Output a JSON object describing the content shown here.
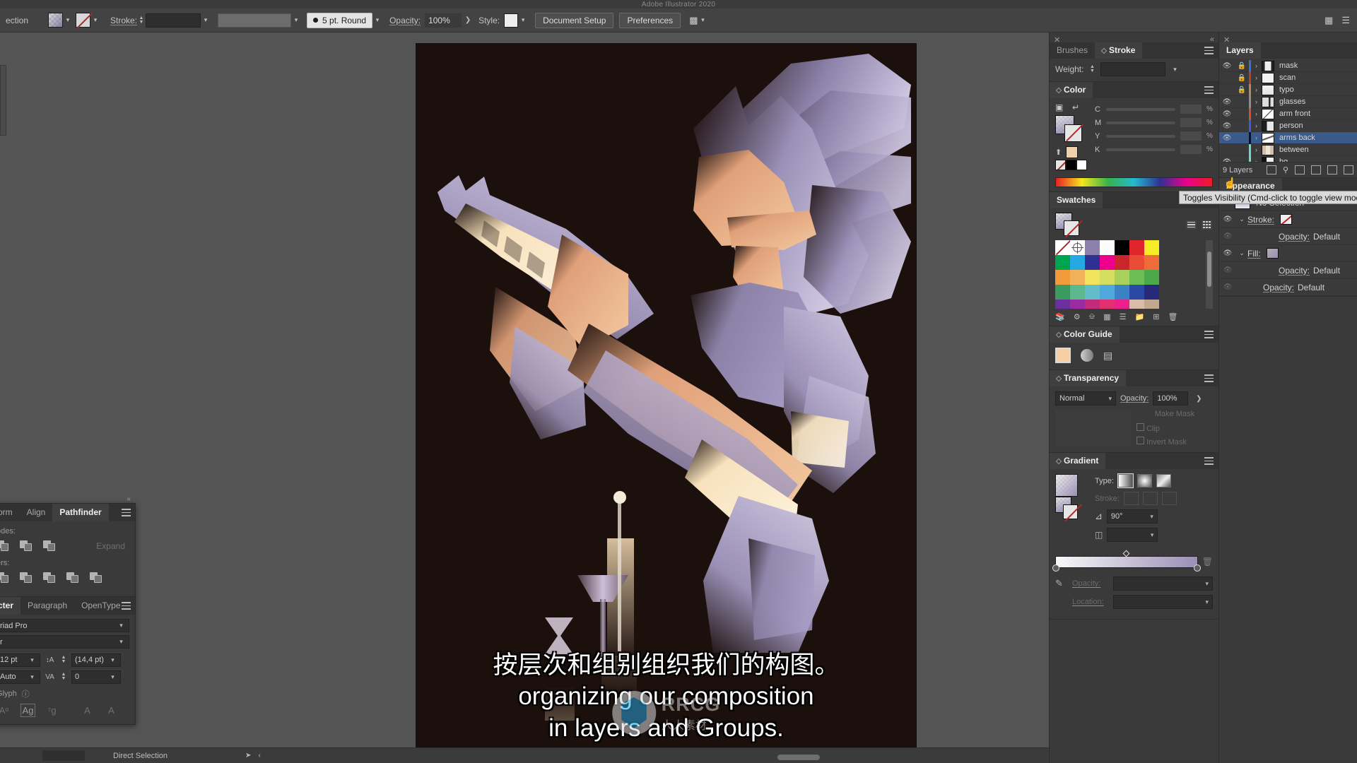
{
  "app": {
    "title": "Adobe Illustrator 2020"
  },
  "options_bar": {
    "selection_label": "ection",
    "stroke_label": "Stroke:",
    "brush_profile": "5 pt. Round",
    "opacity_label": "Opacity:",
    "opacity_value": "100%",
    "style_label": "Style:",
    "document_setup": "Document Setup",
    "preferences": "Preferences",
    "fill_icon": "fill-swatch-icon",
    "stroke_none_icon": "stroke-none-icon",
    "align_icon": "align-to-pixel-icon"
  },
  "left_panels": {
    "tabs": [
      {
        "label": "orm",
        "active": false
      },
      {
        "label": "Align",
        "active": false
      },
      {
        "label": "Pathfinder",
        "active": true
      }
    ],
    "modes_label": "odes:",
    "expand_label": "Expand",
    "makers_label": "ers:",
    "mode_count": 3,
    "maker_count": 5,
    "character": {
      "tabs": [
        {
          "label": "cter",
          "active": true
        },
        {
          "label": "Paragraph",
          "active": false
        },
        {
          "label": "OpenType",
          "active": false
        }
      ],
      "font_family": "riad Pro",
      "font_style": "r",
      "font_size": "12 pt",
      "leading": "(14,4 pt)",
      "kerning": "Auto",
      "tracking": "0",
      "glyph_label": "Glyph",
      "info_icon": "info-icon"
    }
  },
  "canvas": {
    "subtitles": [
      "按层次和组别组织我们的构图。",
      "organizing our composition",
      "in layers and Groups."
    ],
    "watermark": {
      "brand": "RRCG",
      "sub": "人人素材"
    },
    "background_color": "#1c100d",
    "palette": {
      "dark_bg": "#1c100d",
      "purple": "#9b90b8",
      "peach": "#e8a67a",
      "cream": "#f7ddb4",
      "light": "#fdf0d9"
    }
  },
  "status_bar": {
    "zoom_value": "",
    "tool": "Direct Selection"
  },
  "right_dock": {
    "stroke_panel": {
      "tabs": [
        {
          "label": "Brushes",
          "active": false
        },
        {
          "label": "Stroke",
          "active": true
        }
      ],
      "weight_label": "Weight:",
      "weight_value": ""
    },
    "color_panel": {
      "title": "Color",
      "channels": [
        {
          "name": "C",
          "value": ""
        },
        {
          "name": "M",
          "value": ""
        },
        {
          "name": "Y",
          "value": ""
        },
        {
          "name": "K",
          "value": ""
        }
      ],
      "percent_symbol": "%",
      "fill_swatch_color": "#8c80ac",
      "last_color_swatch": "#f0d0ab",
      "small_swatches": [
        "none",
        "#000000",
        "#ffffff"
      ]
    },
    "swatches_panel": {
      "title": "Swatches",
      "view_list_icon": "list-view-icon",
      "view_grid_icon": "grid-view-icon",
      "rows": [
        [
          "none",
          "registration",
          "#8c80ac",
          "#fbfbfb",
          "#000000",
          "#e0252b",
          "#f6eb25"
        ],
        [
          "#00a450",
          "#26a9e0",
          "#2e3192",
          "#ec008c",
          "#c9252c",
          "#e94b35",
          "#ef6c3a"
        ],
        [
          "#f29b3b",
          "#f2b257",
          "#f2e35c",
          "#d4de5e",
          "#a9d05a",
          "#6cbe54",
          "#4aa94b"
        ],
        [
          "#3b9b5e",
          "#5ab98e",
          "#62bcc9",
          "#4fa9dc",
          "#3b82c4",
          "#2a49a5",
          "#262a78"
        ],
        [
          "#6b2fa0",
          "#9a2ba0",
          "#c32a7c",
          "#e0306f",
          "#ec1f8d",
          "#d9bda6",
          "#c0a98f"
        ]
      ],
      "footer_icons": [
        "libraries-icon",
        "color-themes-icon",
        "swatch-options-icon",
        "color-group-icon",
        "swatch-menu-icon",
        "new-group-icon",
        "new-swatch-icon",
        "delete-swatch-icon"
      ]
    },
    "color_guide_panel": {
      "title": "Color Guide",
      "base_color": "#f6cfa4",
      "harmony_icon": "harmony-rules-icon",
      "edit_colors_icon": "edit-colors-icon"
    },
    "transparency_panel": {
      "title": "Transparency",
      "blend_mode": "Normal",
      "opacity_label": "Opacity:",
      "opacity_value": "100%",
      "make_mask": "Make Mask",
      "clip": "Clip",
      "invert_mask": "Invert Mask"
    },
    "gradient_panel": {
      "title": "Gradient",
      "type_label": "Type:",
      "type_options": [
        "linear-gradient-icon",
        "radial-gradient-icon",
        "freeform-gradient-icon"
      ],
      "type_selected": 0,
      "stroke_label": "Stroke:",
      "angle_label": "angle-icon",
      "angle_value": "90°",
      "aspect_icon": "aspect-ratio-icon",
      "opacity_label": "Opacity:",
      "location_label": "Location:",
      "stop_left": "#f6f1e6",
      "stop_right": "#9a8fb5"
    },
    "layers_panel": {
      "title": "Layers",
      "layers": [
        {
          "name": "mask",
          "visible": true,
          "locked": true,
          "color": "#3a6fd8",
          "selected": false
        },
        {
          "name": "scan",
          "visible": false,
          "locked": true,
          "color": "#b4412a",
          "selected": false
        },
        {
          "name": "typo",
          "visible": false,
          "locked": true,
          "color": "#b08a63",
          "selected": false
        },
        {
          "name": "glasses",
          "visible": true,
          "locked": false,
          "color": "#8d8d8d",
          "selected": false
        },
        {
          "name": "arm front",
          "visible": true,
          "locked": false,
          "color": "#d4541f",
          "selected": false
        },
        {
          "name": "person",
          "visible": true,
          "locked": false,
          "color": "#3a5ed8",
          "selected": false
        },
        {
          "name": "arms back",
          "visible": true,
          "locked": false,
          "color": "#111111",
          "selected": true
        },
        {
          "name": "between",
          "visible": true,
          "locked": false,
          "color": "#6fd9c9",
          "selected": false
        },
        {
          "name": "bg",
          "visible": true,
          "locked": false,
          "color": "#6fd9c9",
          "selected": false
        }
      ],
      "count_label": "9 Layers",
      "footer_icons": [
        "locate-object-icon",
        "search-icon",
        "make-clipping-mask-icon",
        "create-new-sublayer-icon",
        "create-new-layer-icon",
        "delete-layer-icon"
      ],
      "tooltip": "Toggles Visibility (Cmd-click to toggle view mod"
    },
    "appearance_panel": {
      "title": "Appearance",
      "selection_state": "No Selection",
      "rows": [
        {
          "label": "Stroke:",
          "value": "",
          "icon": "stroke-none-icon",
          "eye": true,
          "chevron": true,
          "indent": 0
        },
        {
          "label": "Opacity:",
          "value": "Default",
          "icon": "",
          "eye": false,
          "chevron": false,
          "indent": 2
        },
        {
          "label": "Fill:",
          "value": "",
          "icon": "gradient-fill-icon",
          "eye": true,
          "chevron": true,
          "indent": 0
        },
        {
          "label": "Opacity:",
          "value": "Default",
          "icon": "",
          "eye": false,
          "chevron": false,
          "indent": 2
        },
        {
          "label": "Opacity:",
          "value": "Default",
          "icon": "",
          "eye": false,
          "chevron": false,
          "indent": 1
        }
      ]
    }
  }
}
